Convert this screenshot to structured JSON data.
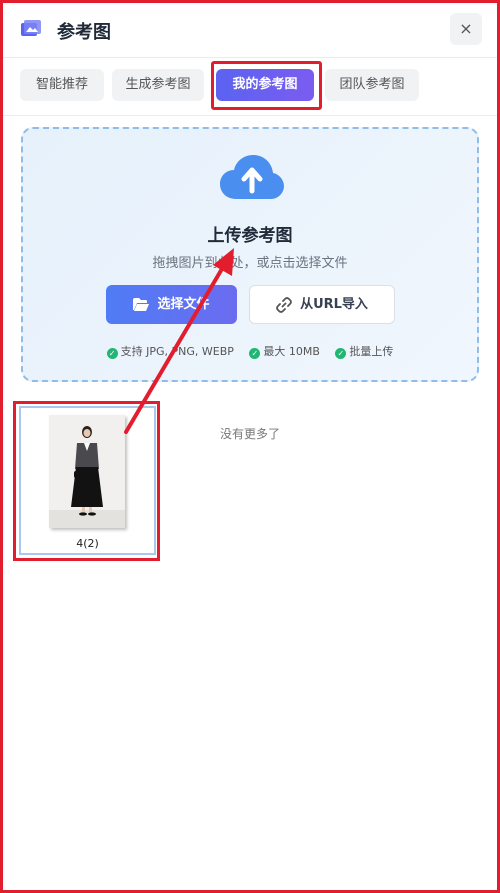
{
  "header": {
    "title": "参考图",
    "title_icon": "image-icon",
    "close_label": "×"
  },
  "tabs": [
    {
      "label": "智能推荐",
      "active": false
    },
    {
      "label": "生成参考图",
      "active": false
    },
    {
      "label": "我的参考图",
      "active": true
    },
    {
      "label": "团队参考图",
      "active": false
    }
  ],
  "upload": {
    "icon": "cloud-upload-icon",
    "title": "上传参考图",
    "subtitle": "拖拽图片到此处，或点击选择文件",
    "select_button": "选择文件",
    "url_button": "从URL导入",
    "features": [
      "支持 JPG, PNG, WEBP",
      "最大 10MB",
      "批量上传"
    ]
  },
  "gallery": {
    "items": [
      {
        "label": "4(2)"
      }
    ],
    "end_text": "没有更多了"
  },
  "colors": {
    "accent": "#6366f1",
    "annotation": "#e11d2e",
    "success": "#22b573"
  }
}
